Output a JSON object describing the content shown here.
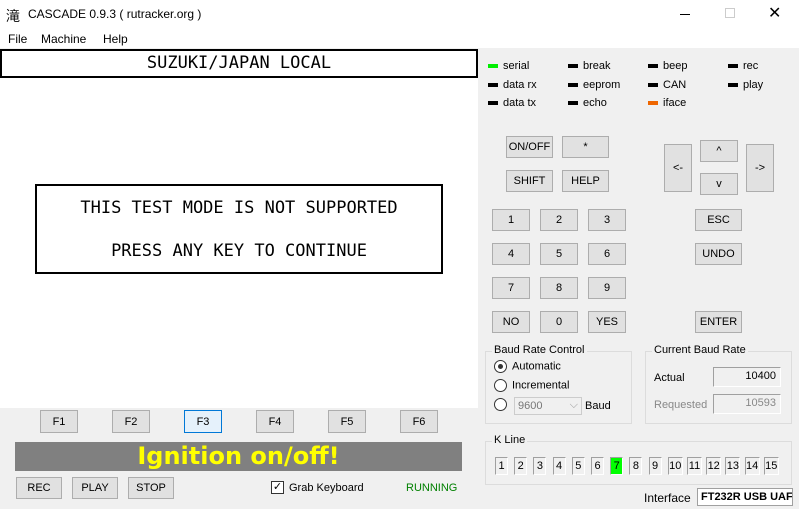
{
  "window": {
    "title": "CASCADE 0.9.3 ( rutracker.org )",
    "icon": "app-kanji-icon",
    "icon_glyph": "滝"
  },
  "menu": [
    "File",
    "Machine",
    "Help"
  ],
  "display": {
    "header": "SUZUKI/JAPAN LOCAL",
    "line1": "THIS TEST MODE IS NOT SUPPORTED",
    "line2": "PRESS ANY KEY TO CONTINUE"
  },
  "fkeys": [
    "F1",
    "F2",
    "F3",
    "F4",
    "F5",
    "F6"
  ],
  "status_banner": "Ignition on/off!",
  "controls": {
    "rec": "REC",
    "play": "PLAY",
    "stop": "STOP",
    "grab_keyboard": "Grab Keyboard",
    "grab_checked": true,
    "state": "RUNNING"
  },
  "indicators": [
    {
      "label": "serial",
      "color": "#00ee00"
    },
    {
      "label": "data rx",
      "color": "#000000"
    },
    {
      "label": "data tx",
      "color": "#000000"
    },
    {
      "label": "break",
      "color": "#000000"
    },
    {
      "label": "eeprom",
      "color": "#000000"
    },
    {
      "label": "echo",
      "color": "#000000"
    },
    {
      "label": "beep",
      "color": "#000000"
    },
    {
      "label": "CAN",
      "color": "#000000"
    },
    {
      "label": "iface",
      "color": "#ee6600"
    },
    {
      "label": "rec",
      "color": "#000000"
    },
    {
      "label": "play",
      "color": "#000000"
    }
  ],
  "keypad": {
    "onoff": "ON/OFF",
    "star": "*",
    "shift": "SHIFT",
    "help": "HELP",
    "digits": [
      "1",
      "2",
      "3",
      "4",
      "5",
      "6",
      "7",
      "8",
      "9"
    ],
    "no": "NO",
    "zero": "0",
    "yes": "YES",
    "esc": "ESC",
    "undo": "UNDO",
    "enter": "ENTER",
    "left": "<-",
    "up": "^",
    "down": "v",
    "right": "->"
  },
  "baud_control": {
    "title": "Baud Rate Control",
    "automatic": "Automatic",
    "incremental": "Incremental",
    "selected": "Automatic",
    "fixed_value": "9600",
    "baud_label": "Baud"
  },
  "current_baud": {
    "title": "Current Baud Rate",
    "actual_label": "Actual",
    "actual": "10400",
    "requested_label": "Requested",
    "requested": "10593"
  },
  "kline": {
    "title": "K Line",
    "lines": [
      "1",
      "2",
      "3",
      "4",
      "5",
      "6",
      "7",
      "8",
      "9",
      "10",
      "11",
      "12",
      "13",
      "14",
      "15"
    ],
    "active": "7",
    "active_color": "#00ff00"
  },
  "interface": {
    "label": "Interface",
    "value": "FT232R USB UAF"
  }
}
